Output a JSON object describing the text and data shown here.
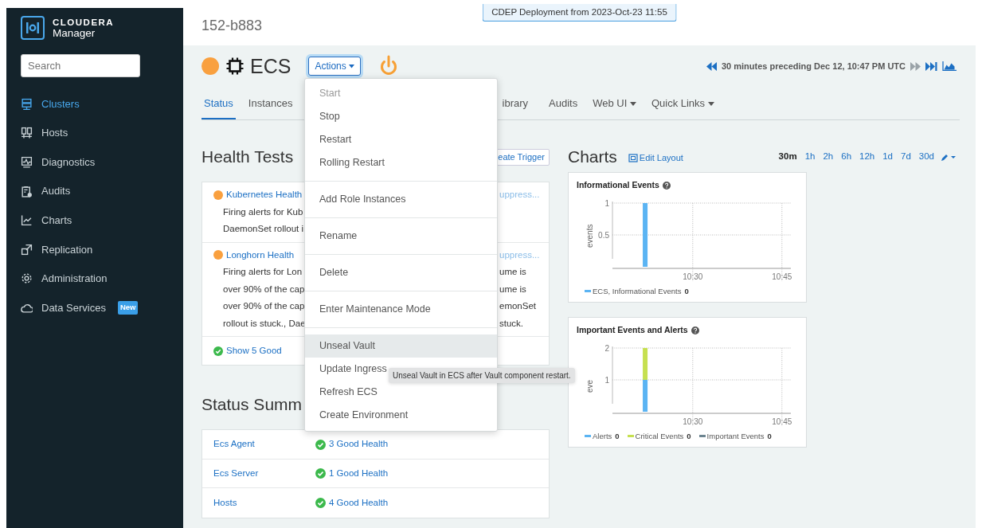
{
  "sidebar": {
    "brand": {
      "name": "CLOUDERA",
      "product": "Manager"
    },
    "search": {
      "placeholder": "Search"
    },
    "items": [
      {
        "label": "Clusters",
        "selected": true
      },
      {
        "label": "Hosts",
        "selected": false
      },
      {
        "label": "Diagnostics",
        "selected": false
      },
      {
        "label": "Audits",
        "selected": false
      },
      {
        "label": "Charts",
        "selected": false
      },
      {
        "label": "Replication",
        "selected": false
      },
      {
        "label": "Administration",
        "selected": false
      },
      {
        "label": "Data Services",
        "selected": false,
        "badge": "New"
      }
    ]
  },
  "header": {
    "title": "152-b883",
    "deployment_banner": "CDEP Deployment from 2023-Oct-23 11:55"
  },
  "service": {
    "name": "ECS",
    "kind": "concerning",
    "actions_button": "Actions"
  },
  "time_range": {
    "text": "30 minutes preceding Dec 12, 10:47 PM UTC"
  },
  "tabs": [
    {
      "label": "Status",
      "selected": true,
      "dropdown": false
    },
    {
      "label": "Instances",
      "selected": false,
      "dropdown": false
    },
    {
      "label": "ibrary",
      "selected": false,
      "dropdown": false
    },
    {
      "label": "Audits",
      "selected": false,
      "dropdown": false
    },
    {
      "label": "Web UI",
      "selected": false,
      "dropdown": true
    },
    {
      "label": "Quick Links",
      "selected": false,
      "dropdown": true
    }
  ],
  "health_tests": {
    "title": "Health Tests",
    "create_trigger": "eate Trigger",
    "items": [
      {
        "name": "Kubernetes Health",
        "kind": "concerning",
        "suppress": "uppress...",
        "lines": [
          {
            "left": "Firing alerts for Kub"
          },
          {
            "left": "DaemonSet rollout i"
          }
        ]
      },
      {
        "name": "Longhorn Health",
        "kind": "concerning",
        "suppress": "uppress...",
        "lines": [
          {
            "left": "Firing alerts for Lon",
            "right": "ume is"
          },
          {
            "left": "over 90% of the cap",
            "right": "ume is"
          },
          {
            "left": "over 90% of the cap",
            "right": "emonSet"
          },
          {
            "left": "rollout is stuck., Dae",
            "right": "stuck."
          }
        ]
      }
    ],
    "show_good": "Show 5 Good"
  },
  "status_summary": {
    "title": "Status Summ",
    "rows": [
      {
        "name": "Ecs Agent",
        "kind": "good",
        "text": "3 Good Health"
      },
      {
        "name": "Ecs Server",
        "kind": "good",
        "text": "1 Good Health"
      },
      {
        "name": "Hosts",
        "kind": "good",
        "text": "4 Good Health"
      }
    ]
  },
  "charts": {
    "title": "Charts",
    "edit_layout": "Edit Layout",
    "ranges": [
      {
        "label": "30m",
        "selected": true
      },
      {
        "label": "1h",
        "selected": false
      },
      {
        "label": "2h",
        "selected": false
      },
      {
        "label": "6h",
        "selected": false
      },
      {
        "label": "12h",
        "selected": false
      },
      {
        "label": "1d",
        "selected": false
      },
      {
        "label": "7d",
        "selected": false
      },
      {
        "label": "30d",
        "selected": false
      }
    ],
    "panels": [
      {
        "title": "Informational Events",
        "legend_values": [
          "0"
        ],
        "chart_data": {
          "type": "bar",
          "ylabel": "events",
          "grid": true,
          "ylim": [
            0,
            1
          ],
          "yticks": [
            0.5,
            1
          ],
          "categories": [
            null,
            null,
            null,
            null,
            null,
            null,
            null,
            null,
            null,
            null,
            null,
            null,
            null,
            "10:30",
            null,
            null,
            null,
            null,
            null,
            null,
            null,
            null,
            null,
            null,
            null,
            null,
            null,
            null,
            "10:45",
            null
          ],
          "series": [
            {
              "name": "ECS, Informational Events",
              "color": "#5bb4f3",
              "values": [
                0,
                0,
                0,
                0,
                0,
                1,
                0,
                0,
                0,
                0,
                0,
                0,
                0,
                0,
                0,
                0,
                0,
                0,
                0,
                0,
                0,
                0,
                0,
                0,
                0,
                0,
                0,
                0,
                0,
                0
              ]
            }
          ]
        }
      },
      {
        "title": "Important Events and Alerts",
        "legend_values": [
          "0",
          "0",
          "0"
        ],
        "chart_data": {
          "type": "bar",
          "ylabel": "eve",
          "grid": true,
          "stacked": true,
          "ylim": [
            0,
            2
          ],
          "yticks": [
            1,
            2
          ],
          "categories": [
            null,
            null,
            null,
            null,
            null,
            null,
            null,
            null,
            null,
            null,
            null,
            null,
            null,
            "10:30",
            null,
            null,
            null,
            null,
            null,
            null,
            null,
            null,
            null,
            null,
            null,
            null,
            null,
            null,
            "10:45",
            null
          ],
          "series": [
            {
              "name": "Alerts",
              "color": "#5bb4f3",
              "values": [
                0,
                0,
                0,
                0,
                0,
                1,
                0,
                0,
                0,
                0,
                0,
                0,
                0,
                0,
                0,
                0,
                0,
                0,
                0,
                0,
                0,
                0,
                0,
                0,
                0,
                0,
                0,
                0,
                0,
                0
              ]
            },
            {
              "name": "Critical Events",
              "color": "#c6e050",
              "values": [
                0,
                0,
                0,
                0,
                0,
                1,
                0,
                0,
                0,
                0,
                0,
                0,
                0,
                0,
                0,
                0,
                0,
                0,
                0,
                0,
                0,
                0,
                0,
                0,
                0,
                0,
                0,
                0,
                0,
                0
              ]
            },
            {
              "name": "Important Events",
              "color": "#6d8591",
              "values": [
                0,
                0,
                0,
                0,
                0,
                0,
                0,
                0,
                0,
                0,
                0,
                0,
                0,
                0,
                0,
                0,
                0,
                0,
                0,
                0,
                0,
                0,
                0,
                0,
                0,
                0,
                0,
                0,
                0,
                0
              ]
            }
          ]
        }
      }
    ]
  },
  "actions_menu": {
    "groups": [
      [
        {
          "label": "Start",
          "disabled": true,
          "highlighted": false
        },
        {
          "label": "Stop",
          "disabled": false,
          "highlighted": false
        },
        {
          "label": "Restart",
          "disabled": false,
          "highlighted": false
        },
        {
          "label": "Rolling Restart",
          "disabled": false,
          "highlighted": false
        }
      ],
      [
        {
          "label": "Add Role Instances",
          "disabled": false,
          "highlighted": false
        }
      ],
      [
        {
          "label": "Rename",
          "disabled": false,
          "highlighted": false
        }
      ],
      [
        {
          "label": "Delete",
          "disabled": false,
          "highlighted": false
        }
      ],
      [
        {
          "label": "Enter Maintenance Mode",
          "disabled": false,
          "highlighted": false
        }
      ],
      [
        {
          "label": "Unseal Vault",
          "disabled": false,
          "highlighted": true
        },
        {
          "label": "Update Ingress",
          "disabled": false,
          "highlighted": false
        },
        {
          "label": "Refresh ECS",
          "disabled": false,
          "highlighted": false
        },
        {
          "label": "Create Environment",
          "disabled": false,
          "highlighted": false
        }
      ]
    ]
  },
  "tooltip": "Unseal Vault in ECS after Vault component restart."
}
